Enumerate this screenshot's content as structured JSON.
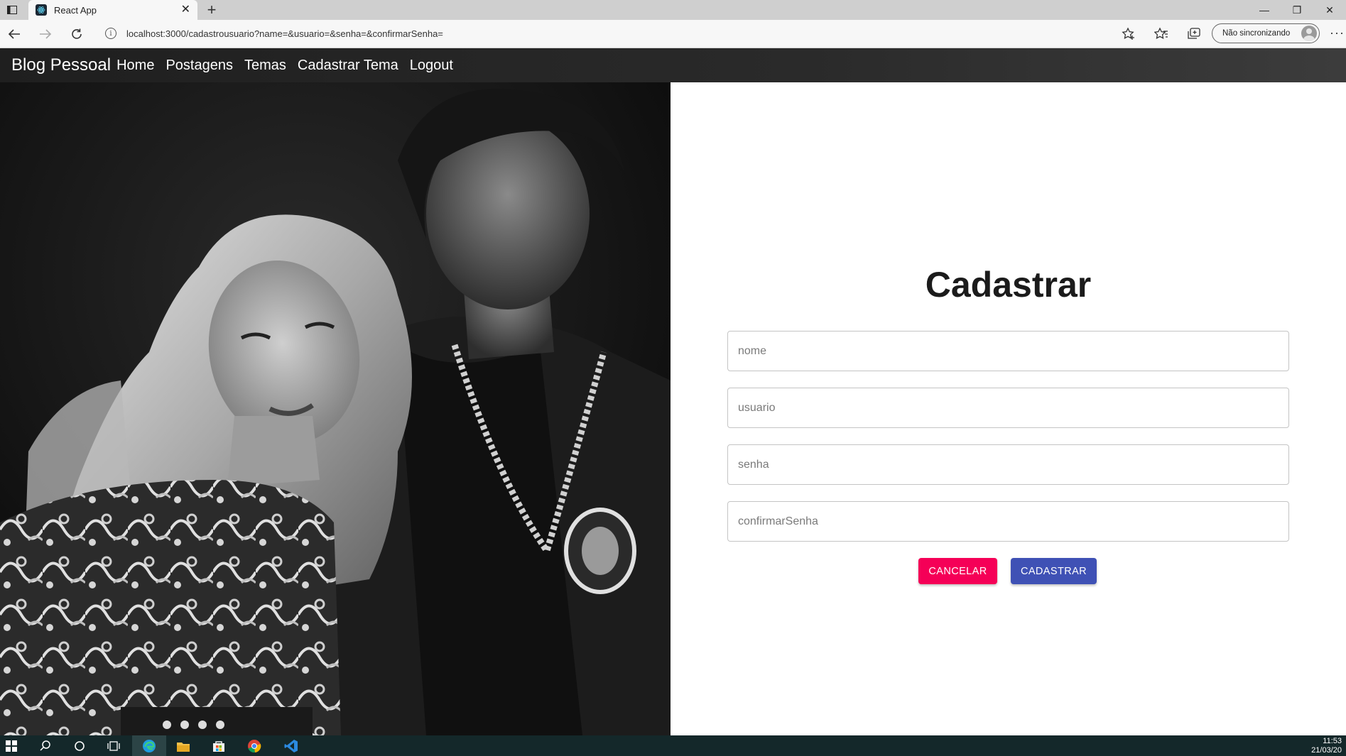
{
  "browser": {
    "tab_title": "React App",
    "url": "localhost:3000/cadastrousuario?name=&usuario=&senha=&confirmarSenha=",
    "profile_label": "Não sincronizando",
    "icons": [
      "back-icon",
      "forward-icon",
      "refresh-icon",
      "info-icon",
      "favorites-add-icon",
      "favorites-icon",
      "collections-icon",
      "more-icon"
    ]
  },
  "navbar": {
    "brand": "Blog Pessoal",
    "links": [
      "Home",
      "Postagens",
      "Temas",
      "Cadastrar Tema",
      "Logout"
    ]
  },
  "form": {
    "title": "Cadastrar",
    "fields": [
      {
        "name": "nome",
        "placeholder": "nome",
        "value": ""
      },
      {
        "name": "usuario",
        "placeholder": "usuario",
        "value": ""
      },
      {
        "name": "senha",
        "placeholder": "senha",
        "value": ""
      },
      {
        "name": "confirmarSenha",
        "placeholder": "confirmarSenha",
        "value": ""
      }
    ],
    "cancel_label": "CANCELAR",
    "submit_label": "CADASTRAR",
    "cancel_color": "#f50057",
    "submit_color": "#3f51b5"
  },
  "taskbar": {
    "time": "11:53",
    "date": "21/03/20",
    "icons": [
      "windows-start-icon",
      "search-icon",
      "cortana-icon",
      "task-view-icon",
      "edge-icon",
      "file-explorer-icon",
      "store-icon",
      "chrome-icon",
      "vscode-icon"
    ]
  }
}
